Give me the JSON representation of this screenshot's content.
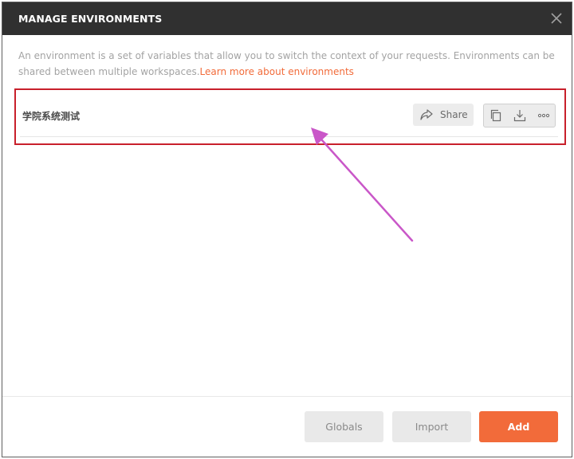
{
  "modal": {
    "title": "MANAGE ENVIRONMENTS",
    "description": "An environment is a set of variables that allow you to switch the context of your requests. Environments can be shared between multiple workspaces.",
    "learn_more_label": "Learn more about environments"
  },
  "environments": [
    {
      "name": "学院系统测试",
      "share_label": "Share"
    }
  ],
  "footer": {
    "globals_label": "Globals",
    "import_label": "Import",
    "add_label": "Add"
  },
  "colors": {
    "accent": "#f26b3a",
    "header_bg": "#303030",
    "highlight_border": "#c8202b",
    "annotation_arrow": "#c957c8"
  },
  "icons": {
    "close": "close-icon",
    "share": "share-icon",
    "duplicate": "duplicate-icon",
    "download": "download-icon",
    "more": "more-icon"
  }
}
